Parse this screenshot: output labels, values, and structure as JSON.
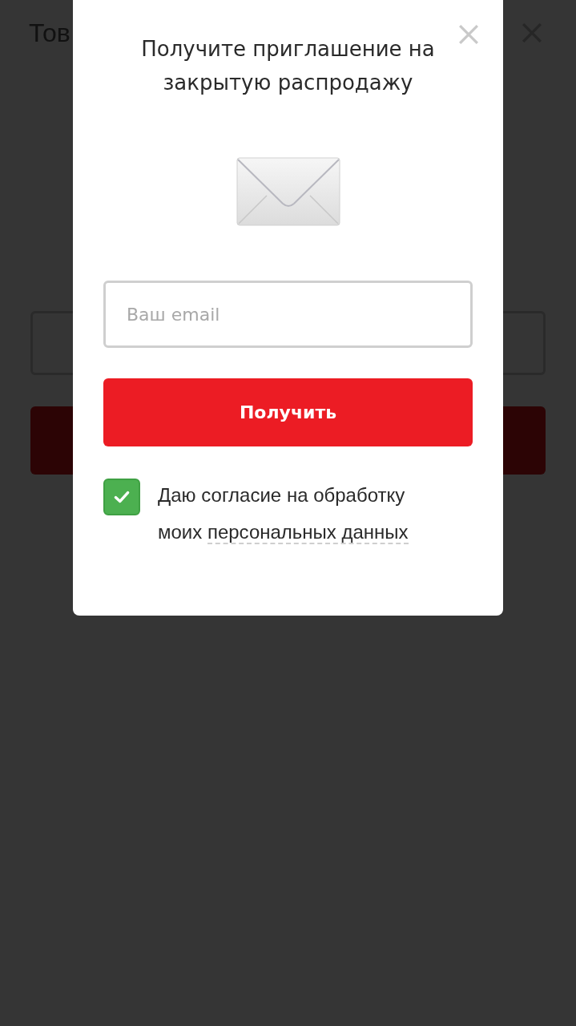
{
  "background_page": {
    "title": "Тов"
  },
  "modal": {
    "title": "Получите приглашение на закрытую распродажу",
    "email_field": {
      "placeholder": "Ваш email"
    },
    "submit_button": "Получить",
    "consent": {
      "checked": true,
      "text": "Даю согласие на обработку моих",
      "link": "персональных данных"
    }
  }
}
